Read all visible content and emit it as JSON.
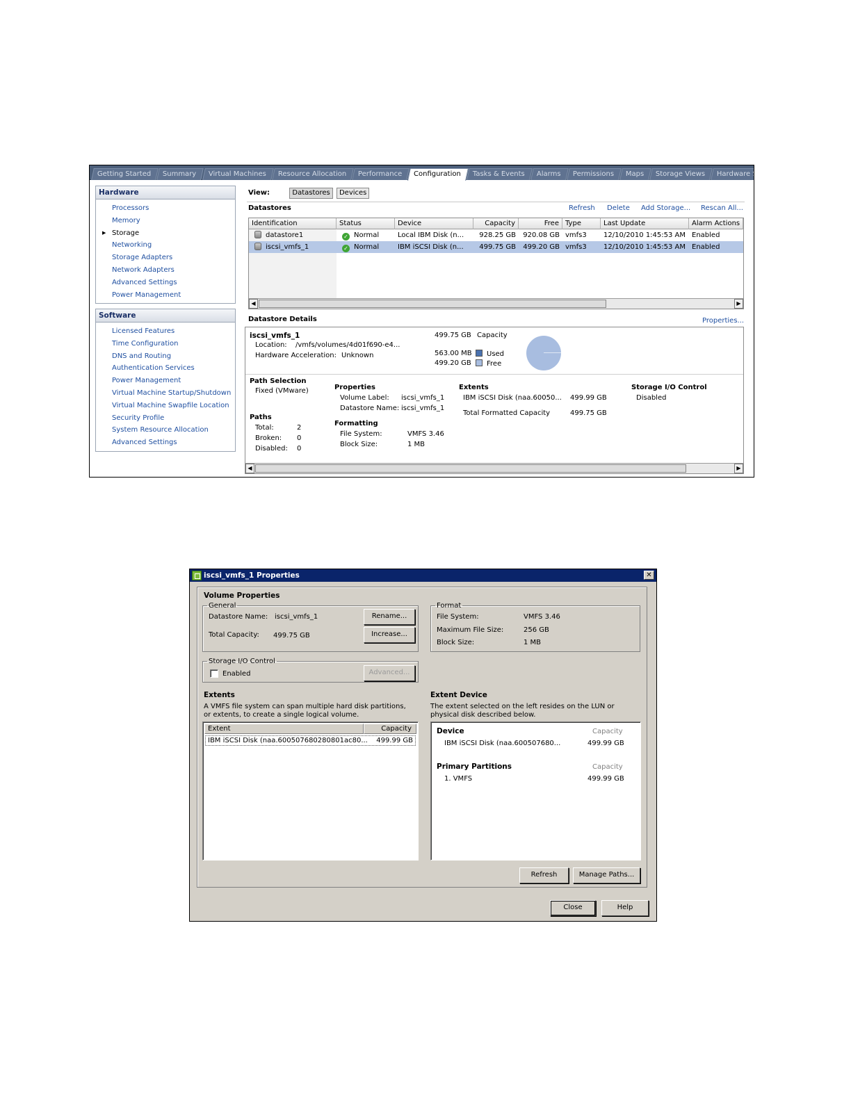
{
  "vsphere": {
    "tabs": [
      "Getting Started",
      "Summary",
      "Virtual Machines",
      "Resource Allocation",
      "Performance",
      "Configuration",
      "Tasks & Events",
      "Alarms",
      "Permissions",
      "Maps",
      "Storage Views",
      "Hardware Status"
    ],
    "active_tab": "Configuration",
    "hardware": {
      "title": "Hardware",
      "items": [
        "Processors",
        "Memory",
        "Storage",
        "Networking",
        "Storage Adapters",
        "Network Adapters",
        "Advanced Settings",
        "Power Management"
      ],
      "selected": "Storage"
    },
    "software": {
      "title": "Software",
      "items": [
        "Licensed Features",
        "Time Configuration",
        "DNS and Routing",
        "Authentication Services",
        "Power Management",
        "Virtual Machine Startup/Shutdown",
        "Virtual Machine Swapfile Location",
        "Security Profile",
        "System Resource Allocation",
        "Advanced Settings"
      ]
    },
    "view": {
      "label": "View:",
      "buttons": [
        "Datastores",
        "Devices"
      ]
    },
    "datastores": {
      "title": "Datastores",
      "actions": [
        "Refresh",
        "Delete",
        "Add Storage...",
        "Rescan All..."
      ],
      "columns": [
        "Identification",
        "Status",
        "Device",
        "Capacity",
        "Free",
        "Type",
        "Last Update",
        "Alarm Actions"
      ],
      "rows": [
        [
          "datastore1",
          "Normal",
          "Local IBM Disk (n...",
          "928.25 GB",
          "920.08 GB",
          "vmfs3",
          "12/10/2010 1:45:53 AM",
          "Enabled"
        ],
        [
          "iscsi_vmfs_1",
          "Normal",
          "IBM iSCSI Disk (n...",
          "499.75 GB",
          "499.20 GB",
          "vmfs3",
          "12/10/2010 1:45:53 AM",
          "Enabled"
        ]
      ],
      "selected_row": 1
    },
    "details": {
      "title": "Datastore Details",
      "properties_link": "Properties...",
      "name": "iscsi_vmfs_1",
      "location_label": "Location:",
      "location": "/vmfs/volumes/4d01f690-e4...",
      "hw_accel_label": "Hardware Acceleration:",
      "hw_accel": "Unknown",
      "capacity_value": "499.75 GB",
      "capacity_label": "Capacity",
      "used_value": "563.00 MB",
      "used_label": "Used",
      "free_value": "499.20 GB",
      "free_label": "Free",
      "used_color": "#4a72b0",
      "free_color": "#a8bde0",
      "path_selection_title": "Path Selection",
      "path_selection": "Fixed (VMware)",
      "paths_title": "Paths",
      "paths_total_label": "Total:",
      "paths_total": "2",
      "paths_broken_label": "Broken:",
      "paths_broken": "0",
      "paths_disabled_label": "Disabled:",
      "paths_disabled": "0",
      "properties_title": "Properties",
      "volume_label_label": "Volume Label:",
      "volume_label": "iscsi_vmfs_1",
      "datastore_name_label": "Datastore Name:",
      "datastore_name": "iscsi_vmfs_1",
      "formatting_title": "Formatting",
      "file_system_label": "File System:",
      "file_system": "VMFS 3.46",
      "block_size_label": "Block Size:",
      "block_size": "1 MB",
      "extents_title": "Extents",
      "extent_device": "IBM iSCSI Disk (naa.60050...",
      "extent_capacity": "499.99 GB",
      "total_formatted_label": "Total Formatted Capacity",
      "total_formatted": "499.75 GB",
      "sioc_title": "Storage I/O Control",
      "sioc": "Disabled"
    }
  },
  "dialog": {
    "title": "iscsi_vmfs_1 Properties",
    "volume_properties": "Volume Properties",
    "general": {
      "legend": "General",
      "datastore_name_label": "Datastore Name:",
      "datastore_name": "iscsi_vmfs_1",
      "total_capacity_label": "Total Capacity:",
      "total_capacity": "499.75 GB",
      "rename_button": "Rename...",
      "increase_button": "Increase..."
    },
    "format": {
      "legend": "Format",
      "file_system_label": "File System:",
      "file_system": "VMFS 3.46",
      "max_file_size_label": "Maximum File Size:",
      "max_file_size": "256 GB",
      "block_size_label": "Block Size:",
      "block_size": "1 MB"
    },
    "sioc": {
      "legend": "Storage I/O Control",
      "enabled_label": "Enabled",
      "enabled": false,
      "advanced_button": "Advanced..."
    },
    "extents": {
      "title": "Extents",
      "description": "A VMFS file system can span multiple hard disk partitions, or extents, to create a single logical volume.",
      "columns": [
        "Extent",
        "Capacity"
      ],
      "rows": [
        [
          "IBM iSCSI Disk (naa.600507680280801ac80...",
          "499.99 GB"
        ]
      ]
    },
    "extent_device": {
      "title": "Extent Device",
      "description": "The extent selected on the left resides on the LUN or physical disk described below.",
      "device_header": "Device",
      "capacity_header": "Capacity",
      "device": "IBM iSCSI Disk (naa.600507680...",
      "device_capacity": "499.99 GB",
      "partitions_header": "Primary Partitions",
      "partitions_capacity_header": "Capacity",
      "partition": "1. VMFS",
      "partition_capacity": "499.99 GB"
    },
    "refresh_button": "Refresh",
    "manage_paths_button": "Manage Paths...",
    "close_button": "Close",
    "help_button": "Help"
  }
}
